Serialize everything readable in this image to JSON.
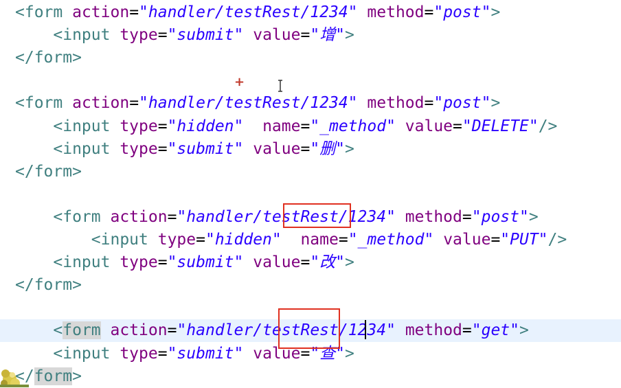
{
  "editor": {
    "lines": [
      [
        {
          "t": "<form ",
          "c": "tag"
        },
        {
          "t": "action",
          "c": "attr"
        },
        {
          "t": "=",
          "c": "eq"
        },
        {
          "t": "\"handler/testRest/1234\"",
          "c": "str"
        },
        {
          "t": " ",
          "c": "eq"
        },
        {
          "t": "method",
          "c": "attr"
        },
        {
          "t": "=",
          "c": "eq"
        },
        {
          "t": "\"post\"",
          "c": "str"
        },
        {
          "t": ">",
          "c": "tag"
        }
      ],
      [
        {
          "t": "    ",
          "c": "eq"
        },
        {
          "t": "<input ",
          "c": "tag"
        },
        {
          "t": "type",
          "c": "attr"
        },
        {
          "t": "=",
          "c": "eq"
        },
        {
          "t": "\"submit\"",
          "c": "str"
        },
        {
          "t": " ",
          "c": "eq"
        },
        {
          "t": "value",
          "c": "attr"
        },
        {
          "t": "=",
          "c": "eq"
        },
        {
          "t": "\"增\"",
          "c": "str"
        },
        {
          "t": ">",
          "c": "tag"
        }
      ],
      [
        {
          "t": "</form>",
          "c": "tag"
        }
      ],
      [],
      [
        {
          "t": "<form ",
          "c": "tag"
        },
        {
          "t": "action",
          "c": "attr"
        },
        {
          "t": "=",
          "c": "eq"
        },
        {
          "t": "\"handler/testRest/1234\"",
          "c": "str"
        },
        {
          "t": " ",
          "c": "eq"
        },
        {
          "t": "method",
          "c": "attr"
        },
        {
          "t": "=",
          "c": "eq"
        },
        {
          "t": "\"post\"",
          "c": "str"
        },
        {
          "t": ">",
          "c": "tag"
        }
      ],
      [
        {
          "t": "    ",
          "c": "eq"
        },
        {
          "t": "<input ",
          "c": "tag"
        },
        {
          "t": "type",
          "c": "attr"
        },
        {
          "t": "=",
          "c": "eq"
        },
        {
          "t": "\"hidden\"",
          "c": "str"
        },
        {
          "t": "  ",
          "c": "eq"
        },
        {
          "t": "name",
          "c": "attr"
        },
        {
          "t": "=",
          "c": "eq"
        },
        {
          "t": "\"_method\"",
          "c": "str"
        },
        {
          "t": " ",
          "c": "eq"
        },
        {
          "t": "value",
          "c": "attr"
        },
        {
          "t": "=",
          "c": "eq"
        },
        {
          "t": "\"DELETE\"",
          "c": "str"
        },
        {
          "t": "/>",
          "c": "tag"
        }
      ],
      [
        {
          "t": "    ",
          "c": "eq"
        },
        {
          "t": "<input ",
          "c": "tag"
        },
        {
          "t": "type",
          "c": "attr"
        },
        {
          "t": "=",
          "c": "eq"
        },
        {
          "t": "\"submit\"",
          "c": "str"
        },
        {
          "t": " ",
          "c": "eq"
        },
        {
          "t": "value",
          "c": "attr"
        },
        {
          "t": "=",
          "c": "eq"
        },
        {
          "t": "\"删\"",
          "c": "str"
        },
        {
          "t": ">",
          "c": "tag"
        }
      ],
      [
        {
          "t": "</form>",
          "c": "tag"
        }
      ],
      [],
      [
        {
          "t": "    ",
          "c": "eq"
        },
        {
          "t": "<form ",
          "c": "tag"
        },
        {
          "t": "action",
          "c": "attr"
        },
        {
          "t": "=",
          "c": "eq"
        },
        {
          "t": "\"handler/testRest/1234\"",
          "c": "str"
        },
        {
          "t": " ",
          "c": "eq"
        },
        {
          "t": "method",
          "c": "attr"
        },
        {
          "t": "=",
          "c": "eq"
        },
        {
          "t": "\"post\"",
          "c": "str"
        },
        {
          "t": ">",
          "c": "tag"
        }
      ],
      [
        {
          "t": "        ",
          "c": "eq"
        },
        {
          "t": "<input ",
          "c": "tag"
        },
        {
          "t": "type",
          "c": "attr"
        },
        {
          "t": "=",
          "c": "eq"
        },
        {
          "t": "\"hidden\"",
          "c": "str"
        },
        {
          "t": "  ",
          "c": "eq"
        },
        {
          "t": "name",
          "c": "attr"
        },
        {
          "t": "=",
          "c": "eq"
        },
        {
          "t": "\"_method\"",
          "c": "str"
        },
        {
          "t": " ",
          "c": "eq"
        },
        {
          "t": "value",
          "c": "attr"
        },
        {
          "t": "=",
          "c": "eq"
        },
        {
          "t": "\"PUT\"",
          "c": "str"
        },
        {
          "t": "/>",
          "c": "tag"
        }
      ],
      [
        {
          "t": "    ",
          "c": "eq"
        },
        {
          "t": "<input ",
          "c": "tag"
        },
        {
          "t": "type",
          "c": "attr"
        },
        {
          "t": "=",
          "c": "eq"
        },
        {
          "t": "\"submit\"",
          "c": "str"
        },
        {
          "t": " ",
          "c": "eq"
        },
        {
          "t": "value",
          "c": "attr"
        },
        {
          "t": "=",
          "c": "eq"
        },
        {
          "t": "\"改\"",
          "c": "str"
        },
        {
          "t": ">",
          "c": "tag"
        }
      ],
      [
        {
          "t": "</form>",
          "c": "tag"
        }
      ],
      [],
      [
        {
          "t": "    ",
          "c": "eq"
        },
        {
          "t": "<",
          "c": "tag"
        },
        {
          "t": "form",
          "c": "tag matched"
        },
        {
          "t": " ",
          "c": "tag"
        },
        {
          "t": "action",
          "c": "attr"
        },
        {
          "t": "=",
          "c": "eq"
        },
        {
          "t": "\"handler/testRest/1234\"",
          "c": "str"
        },
        {
          "t": " ",
          "c": "eq"
        },
        {
          "t": "method",
          "c": "attr"
        },
        {
          "t": "=",
          "c": "eq"
        },
        {
          "t": "\"get\"",
          "c": "str"
        },
        {
          "t": ">",
          "c": "tag"
        }
      ],
      [
        {
          "t": "    ",
          "c": "eq"
        },
        {
          "t": "<input ",
          "c": "tag"
        },
        {
          "t": "type",
          "c": "attr"
        },
        {
          "t": "=",
          "c": "eq"
        },
        {
          "t": "\"submit\"",
          "c": "str"
        },
        {
          "t": " ",
          "c": "eq"
        },
        {
          "t": "value",
          "c": "attr"
        },
        {
          "t": "=",
          "c": "eq"
        },
        {
          "t": "\"查\"",
          "c": "str"
        },
        {
          "t": ">",
          "c": "tag"
        }
      ],
      [
        {
          "t": "</",
          "c": "tag"
        },
        {
          "t": "form",
          "c": "tag matched"
        },
        {
          "t": ">",
          "c": "tag"
        }
      ]
    ],
    "current_line_index": 14
  },
  "overlay": {
    "marker_glyph": "+",
    "marker_color": "#c0392b",
    "annotation_color": "#e03020"
  },
  "colors": {
    "tag": "#3f7f7f",
    "attribute": "#7f007f",
    "string": "#2a00ff",
    "current_line_bg": "#e8f2fe",
    "matched_bracket_bg": "#d8d8d8"
  }
}
